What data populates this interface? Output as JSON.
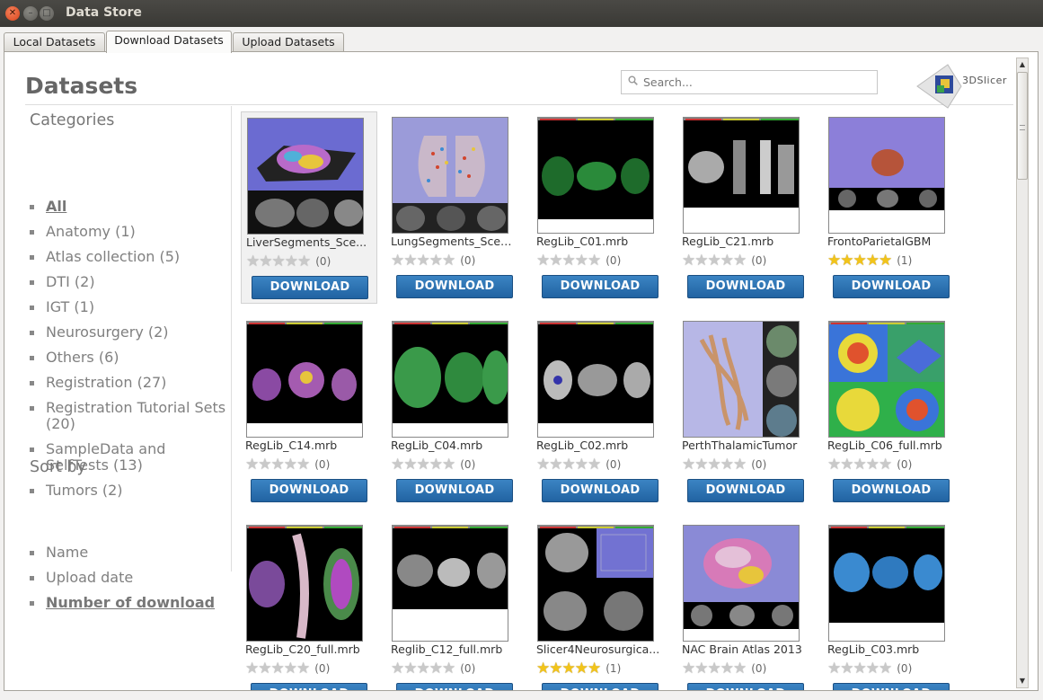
{
  "window": {
    "title": "Data Store",
    "close_glyph": "✕",
    "min_glyph": "–",
    "max_glyph": "□"
  },
  "tabs": [
    {
      "label": "Local Datasets",
      "active": false
    },
    {
      "label": "Download Datasets",
      "active": true
    },
    {
      "label": "Upload Datasets",
      "active": false
    }
  ],
  "page": {
    "title": "Datasets",
    "logo_text": "3DSlicer",
    "search_placeholder": "Search..."
  },
  "sidebar": {
    "categories_heading": "Categories",
    "categories": [
      {
        "label": "All",
        "selected": true
      },
      {
        "label": "Anatomy (1)"
      },
      {
        "label": "Atlas collection (5)"
      },
      {
        "label": "DTI (2)"
      },
      {
        "label": "IGT (1)"
      },
      {
        "label": "Neurosurgery (2)"
      },
      {
        "label": "Others (6)"
      },
      {
        "label": "Registration (27)"
      },
      {
        "label": "Registration Tutorial Sets (20)"
      },
      {
        "label": "SampleData and SelfTests (13)"
      },
      {
        "label": "Tumors (2)"
      }
    ],
    "sort_heading": "Sort by",
    "sort_options": [
      {
        "label": "Name"
      },
      {
        "label": "Upload date"
      },
      {
        "label": "Number of download",
        "selected": true
      }
    ]
  },
  "download_label": "DOWNLOAD",
  "datasets": [
    {
      "name": "LiverSegments_Sce...",
      "stars": 0,
      "count": "(0)",
      "thumb": "liver"
    },
    {
      "name": "LungSegments_Scen...",
      "stars": 0,
      "count": "(0)",
      "thumb": "lung"
    },
    {
      "name": "RegLib_C01.mrb",
      "stars": 0,
      "count": "(0)",
      "thumb": "green-brain"
    },
    {
      "name": "RegLib_C21.mrb",
      "stars": 0,
      "count": "(0)",
      "thumb": "knee"
    },
    {
      "name": "FrontoParietalGBM",
      "stars": 5,
      "count": "(1)",
      "thumb": "head-3d"
    },
    {
      "name": "RegLib_C14.mrb",
      "stars": 0,
      "count": "(0)",
      "thumb": "color-brain"
    },
    {
      "name": "RegLib_C04.mrb",
      "stars": 0,
      "count": "(0)",
      "thumb": "green-brain-large"
    },
    {
      "name": "RegLib_C02.mrb",
      "stars": 0,
      "count": "(0)",
      "thumb": "gray-brain"
    },
    {
      "name": "PerthThalamicTumor",
      "stars": 0,
      "count": "(0)",
      "thumb": "tracts"
    },
    {
      "name": "RegLib_C06_full.mrb",
      "stars": 0,
      "count": "(0)",
      "thumb": "heatmap"
    },
    {
      "name": "RegLib_C20_full.mrb",
      "stars": 0,
      "count": "(0)",
      "thumb": "spine"
    },
    {
      "name": "Reglib_C12_full.mrb",
      "stars": 0,
      "count": "(0)",
      "thumb": "abdomen"
    },
    {
      "name": "Slicer4Neurosurgica...",
      "stars": 5,
      "count": "(1)",
      "thumb": "neuro"
    },
    {
      "name": "NAC Brain Atlas 2013",
      "stars": 0,
      "count": "(0)",
      "thumb": "atlas"
    },
    {
      "name": "RegLib_C03.mrb",
      "stars": 0,
      "count": "(0)",
      "thumb": "blue-brain"
    }
  ],
  "colors": {
    "download_button": "#2a6fb0",
    "star_on": "#f2c419",
    "star_off": "#c9c9c9",
    "close_button": "#e8562a"
  }
}
